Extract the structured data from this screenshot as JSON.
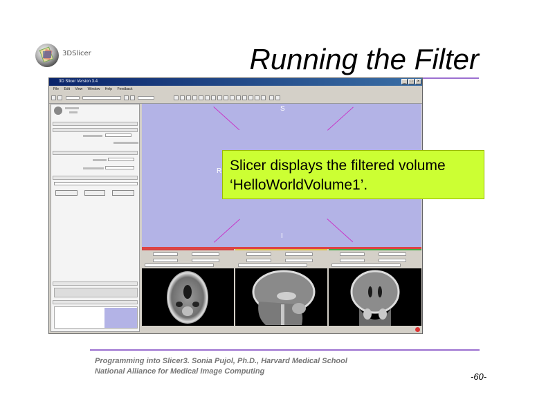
{
  "slide": {
    "logo_text": "3DSlicer",
    "title": "Running the Filter",
    "callout_line1": "Slicer displays the filtered volume",
    "callout_line2": "‘HelloWorldVolume1’.",
    "footer_line1": "Programming into Slicer3. Sonia Pujol, Ph.D., Harvard Medical School",
    "footer_line2": "National Alliance for Medical Image Computing",
    "page_number": "-60-"
  },
  "app": {
    "window_title": "3D Slicer Version 3.4",
    "menu": [
      "File",
      "Edit",
      "View",
      "Window",
      "Help",
      "Feedback"
    ],
    "view_labels": {
      "superior": "S",
      "right": "R",
      "inferior": "I"
    }
  },
  "colors": {
    "accent_rule": "#9b6fd0",
    "callout_bg": "#ccff33",
    "view_bg": "#b3b3e6",
    "slice_red": "#d44444",
    "slice_yellow": "#e0c040",
    "slice_green": "#44aa44"
  }
}
